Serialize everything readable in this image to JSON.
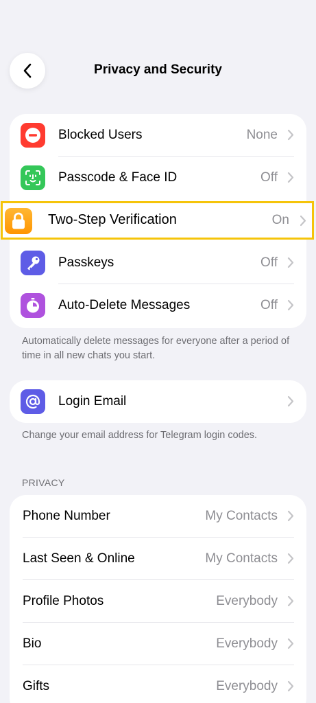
{
  "header": {
    "title": "Privacy and Security"
  },
  "security_group": {
    "items": [
      {
        "label": "Blocked Users",
        "value": "None",
        "icon": "minus-circle-icon",
        "color": "#ff3b30"
      },
      {
        "label": "Passcode & Face ID",
        "value": "Off",
        "icon": "face-id-icon",
        "color": "#34c759"
      },
      {
        "label": "Two-Step Verification",
        "value": "On",
        "icon": "lock-icon",
        "color": "#ff9500"
      },
      {
        "label": "Passkeys",
        "value": "Off",
        "icon": "key-icon",
        "color": "#5e5ce6"
      },
      {
        "label": "Auto-Delete Messages",
        "value": "Off",
        "icon": "timer-icon",
        "color": "#af52de"
      }
    ],
    "footer": "Automatically delete messages for everyone after a period of time in all new chats you start."
  },
  "email_group": {
    "label": "Login Email",
    "icon": "at-sign-icon",
    "color": "#5e5ce6",
    "footer": "Change your email address for Telegram login codes."
  },
  "privacy_group": {
    "header": "PRIVACY",
    "items": [
      {
        "label": "Phone Number",
        "value": "My Contacts"
      },
      {
        "label": "Last Seen & Online",
        "value": "My Contacts"
      },
      {
        "label": "Profile Photos",
        "value": "Everybody"
      },
      {
        "label": "Bio",
        "value": "Everybody"
      },
      {
        "label": "Gifts",
        "value": "Everybody"
      }
    ]
  },
  "highlight_color": "#f5c40a"
}
